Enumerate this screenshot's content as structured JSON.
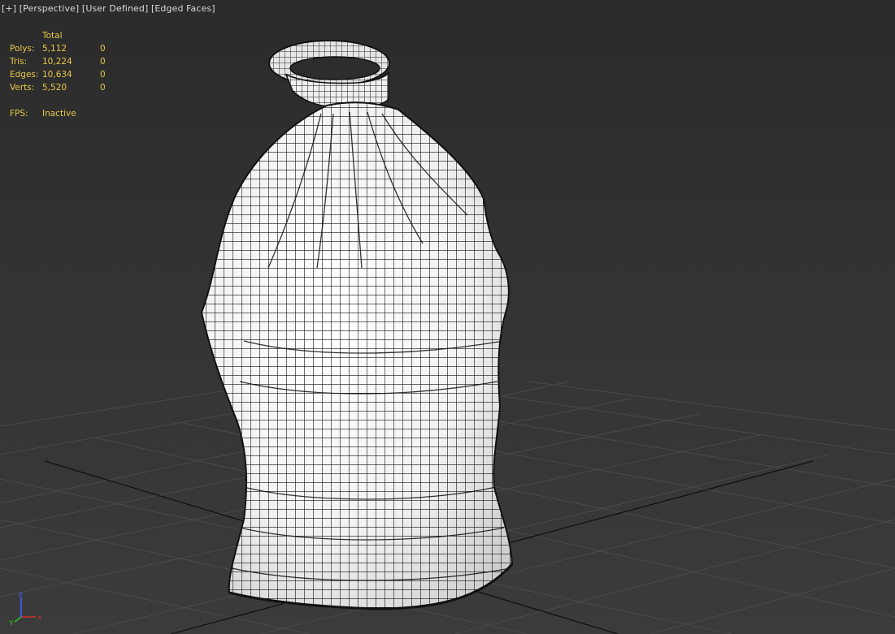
{
  "viewport": {
    "labels": {
      "plus": "[+]",
      "view": "[Perspective]",
      "shading_style": "[User Defined]",
      "edged": "[Edged Faces]"
    },
    "stats": {
      "header": "Total",
      "rows": [
        {
          "label": "Polys:",
          "total": "5,112",
          "selected": "0"
        },
        {
          "label": "Tris:",
          "total": "10,224",
          "selected": "0"
        },
        {
          "label": "Edges:",
          "total": "10,634",
          "selected": "0"
        },
        {
          "label": "Verts:",
          "total": "5,520",
          "selected": "0"
        }
      ],
      "fps_label": "FPS:",
      "fps_value": "Inactive"
    },
    "gizmo": {
      "x": "x",
      "y": "y",
      "z": "z"
    },
    "colors": {
      "stats_text": "#e6c84a",
      "label_text": "#d8d8d8",
      "axis_x": "#d03030",
      "axis_y": "#30c030",
      "axis_z": "#4060ff"
    }
  }
}
